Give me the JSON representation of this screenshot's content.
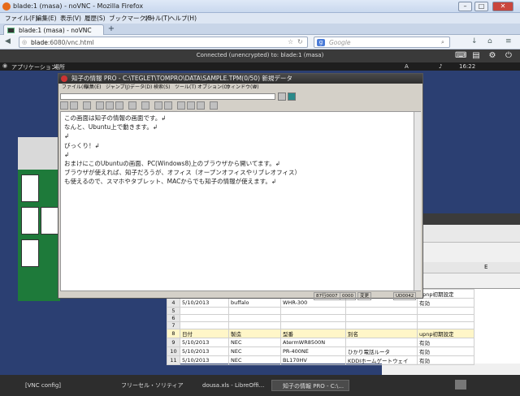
{
  "firefox": {
    "window_title": "blade:1 (masa) - noVNC - Mozilla Firefox",
    "menus": [
      "ファイル(F)",
      "編集(E)",
      "表示(V)",
      "履歴(S)",
      "ブックマーク(B)",
      "ツール(T)",
      "ヘルプ(H)"
    ],
    "tab_label": "blade:1 (masa) - noVNC",
    "tab_add": "+",
    "url_host": "blade",
    "url_rest": ":6080/vnc.html",
    "search_placeholder": "Google",
    "search_engine_letter": "g"
  },
  "novnc": {
    "status": "Connected (unencrypted) to: blade:1 (masa)"
  },
  "gnome": {
    "applications": "アプリケーション",
    "places": "場所",
    "clock": "16:22"
  },
  "chishiki": {
    "title": "知子の情報 PRO - C:\\TEGLET\\TOMPRO\\DATA\\SAMPLE.TPM(0/50) 新規データ",
    "menus": [
      "ファイル(F)",
      "編集(E)",
      "ジャンプ(J)",
      "データ(D)",
      "検索(S)",
      "ツール(T)",
      "オプション(O)",
      "ウィンドウ(W)",
      "?"
    ],
    "text": "この画面は知子の情報の画面です。↲\nなんと、Ubuntu上で動きます。↲\n↲\nびっくり！↲\n↲\nおまけにこのUbuntuの画面、PC(Windows8)上のブラウザから開いてます。↲\nブラウザが使えれば、知子だろうが、オフィス（オープンオフィスやリブレオフィス）\nも使えるので、スマホやタブレット、MACからでも知子の情報が使えます。↲",
    "status_items": [
      "87行0007",
      "0000",
      "変更",
      "UD0042"
    ]
  },
  "spreadsheet": {
    "header_col": "E",
    "rows": [
      {
        "n": "3",
        "date": "5/10/2013",
        "maker": "buffalo",
        "model": "WHR-G301N",
        "name": "",
        "upnp": "upnp初期設定"
      },
      {
        "n": "4",
        "date": "5/10/2013",
        "maker": "buffalo",
        "model": "WHR-300",
        "name": "",
        "upnp": "有効"
      },
      {
        "n": "5",
        "date": "",
        "maker": "",
        "model": "",
        "name": "",
        "upnp": ""
      },
      {
        "n": "6",
        "date": "",
        "maker": "",
        "model": "",
        "name": "",
        "upnp": ""
      },
      {
        "n": "7",
        "date": "",
        "maker": "",
        "model": "",
        "name": "",
        "upnp": ""
      },
      {
        "n": "8",
        "date": "日付",
        "maker": "製造",
        "model": "型番",
        "name": "別名",
        "upnp": "upnp初期設定"
      },
      {
        "n": "9",
        "date": "5/10/2013",
        "maker": "NEC",
        "model": "AtermWR8500N",
        "name": "",
        "upnp": "有効"
      },
      {
        "n": "10",
        "date": "5/10/2013",
        "maker": "NEC",
        "model": "PR-400NE",
        "name": "ひかり電話ルータ",
        "upnp": "有効"
      },
      {
        "n": "11",
        "date": "5/10/2013",
        "maker": "NEC",
        "model": "BL170HV",
        "name": "KDDIホームゲートウェイ",
        "upnp": "有効"
      }
    ]
  },
  "taskbar": {
    "items": [
      "[VNC config]",
      "フリーセル・ソリティア",
      "dousa.xls - LibreOffi...",
      "知子の情報 PRO - C:\\..."
    ]
  }
}
